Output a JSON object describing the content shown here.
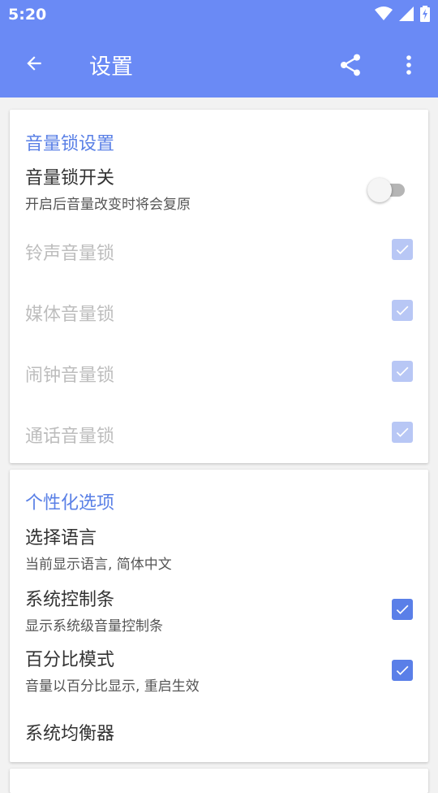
{
  "status_bar": {
    "time": "5:20",
    "icons": [
      "wifi-icon",
      "signal-icon",
      "battery-charging-icon"
    ]
  },
  "app_bar": {
    "title": "设置",
    "back_icon": "arrow-left-icon",
    "share_icon": "share-icon",
    "more_icon": "more-vert-icon",
    "color": "#6a8af5"
  },
  "volume_lock": {
    "section_title": "音量锁设置",
    "switch": {
      "title": "音量锁开关",
      "summary": "开启后音量改变时将会复原",
      "on": false
    },
    "items": [
      {
        "label": "铃声音量锁",
        "checked": true,
        "enabled": false
      },
      {
        "label": "媒体音量锁",
        "checked": true,
        "enabled": false
      },
      {
        "label": "闹钟音量锁",
        "checked": true,
        "enabled": false
      },
      {
        "label": "通话音量锁",
        "checked": true,
        "enabled": false
      }
    ]
  },
  "personalization": {
    "section_title": "个性化选项",
    "language": {
      "title": "选择语言",
      "summary": "当前显示语言, 简体中文"
    },
    "system_bar": {
      "title": "系统控制条",
      "summary": "显示系统级音量控制条",
      "checked": true
    },
    "percent_mode": {
      "title": "百分比模式",
      "summary": "音量以百分比显示, 重启生效",
      "checked": true
    },
    "equalizer": {
      "title": "系统均衡器"
    }
  },
  "colors": {
    "accent": "#5a80e6",
    "checkbox": "#5a7fe8",
    "checkbox_disabled": "#b8c7f5",
    "disabled_text": "#bdbdbd"
  }
}
